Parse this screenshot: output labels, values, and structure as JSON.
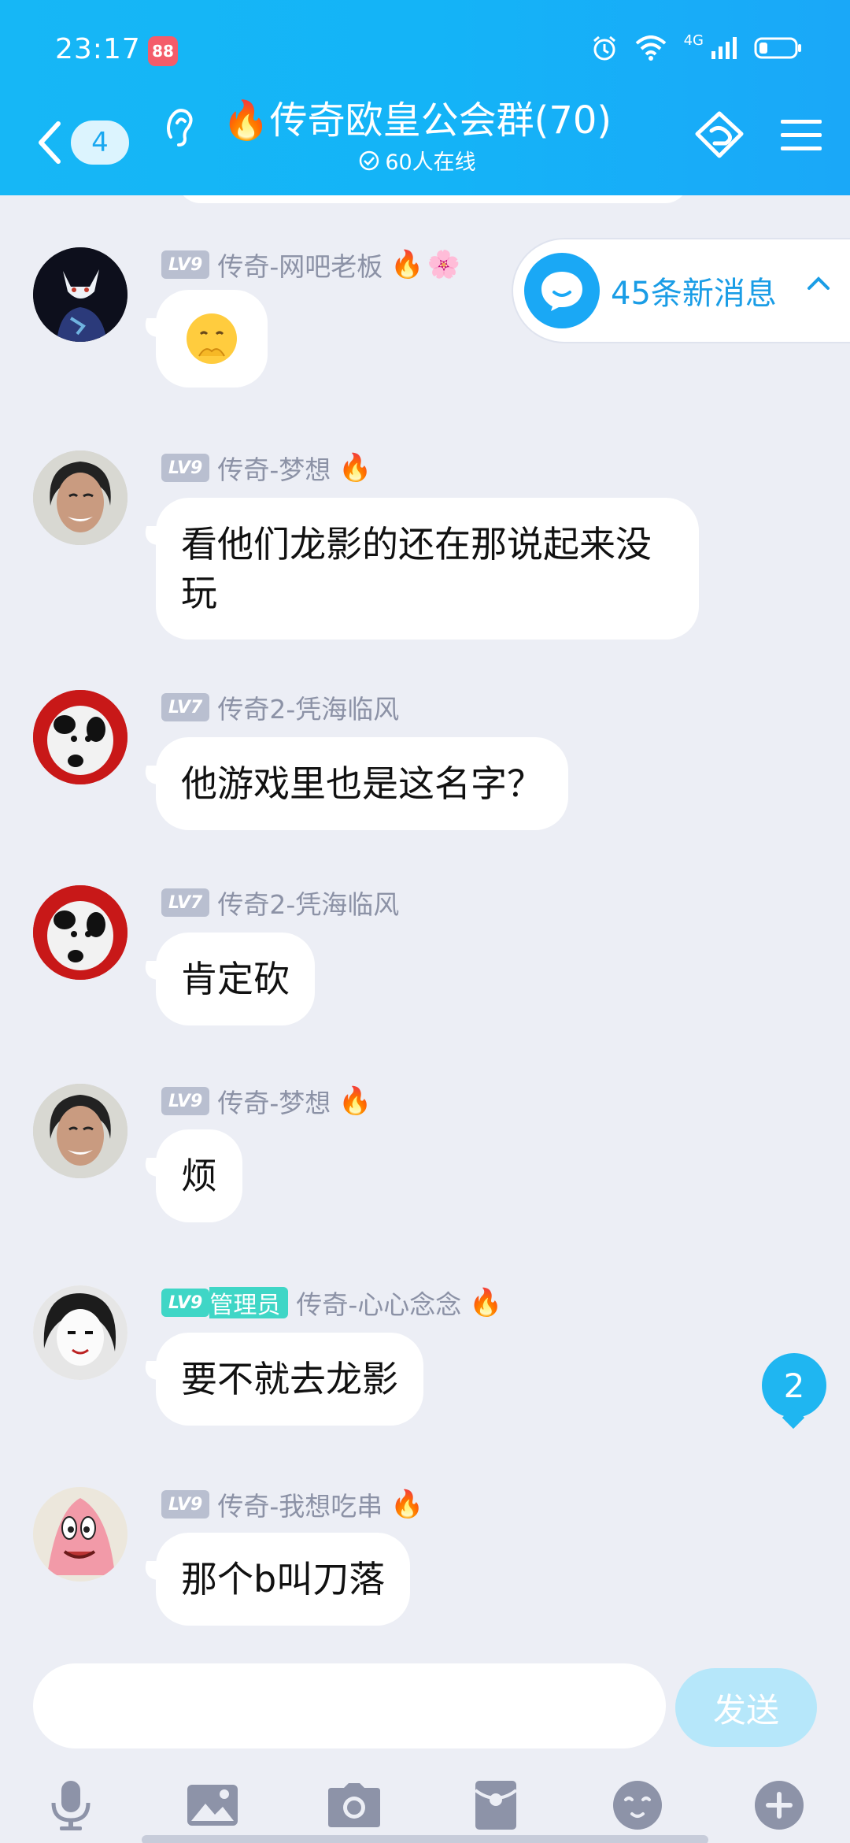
{
  "status_bar": {
    "time": "23:17",
    "app_badge": "88",
    "network": "4G"
  },
  "header": {
    "back_count": "4",
    "group_title": "传奇欧皇公会群(70)",
    "online_text": "60人在线"
  },
  "new_messages": {
    "label": "45条新消息"
  },
  "messages": [
    {
      "level": "LV9",
      "name": "传奇-网吧老板",
      "text": ""
    },
    {
      "level": "LV9",
      "name": "传奇-梦想",
      "text": "看他们龙影的还在那说起来没玩"
    },
    {
      "level": "LV7",
      "name": "传奇2-凭海临风",
      "text": "他游戏里也是这名字？"
    },
    {
      "level": "LV7",
      "name": "传奇2-凭海临风",
      "text": "肯定砍"
    },
    {
      "level": "LV9",
      "name": "传奇-梦想",
      "text": "烦"
    },
    {
      "level": "LV9",
      "role": "管理员",
      "name": "传奇-心心念念",
      "text": "要不就去龙影"
    },
    {
      "level": "LV9",
      "name": "传奇-我想吃串",
      "text": "那个b叫刀落"
    }
  ],
  "unread_mentions": "2",
  "input": {
    "placeholder": "",
    "send_label": "发送"
  },
  "toolbar_icons": [
    "microphone-icon",
    "image-icon",
    "camera-icon",
    "red-packet-icon",
    "emoji-icon",
    "plus-icon"
  ],
  "colors": {
    "accent": "#14b4f7",
    "bubble": "#ffffff",
    "background": "#eceef5",
    "admin": "#3fd6c6"
  }
}
